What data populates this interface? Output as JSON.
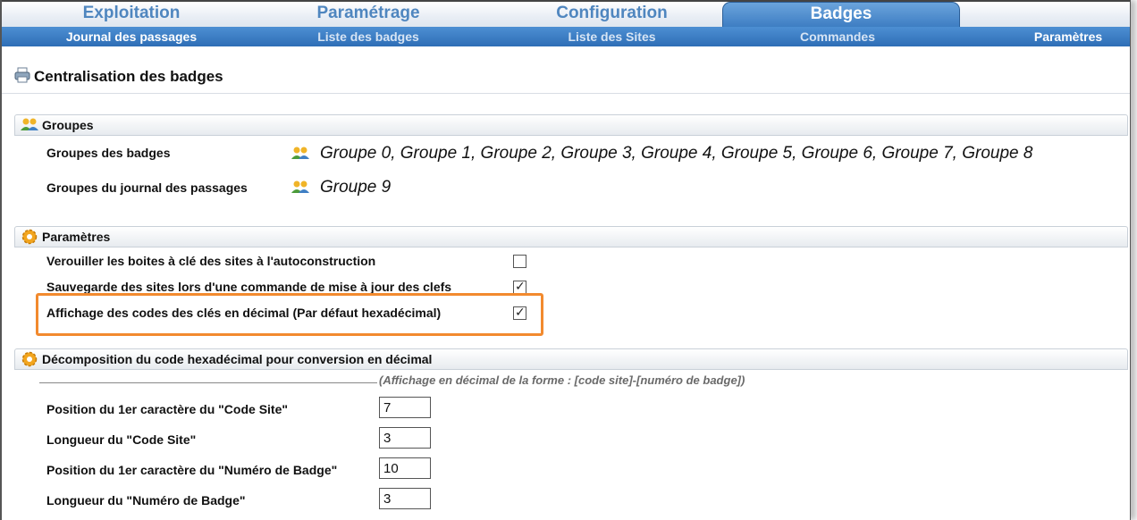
{
  "tabs": {
    "exploitation": "Exploitation",
    "parametrage": "Paramétrage",
    "configuration": "Configuration",
    "badges": "Badges"
  },
  "subnav": {
    "journal": "Journal des passages",
    "liste_badges": "Liste des badges",
    "liste_sites": "Liste des Sites",
    "commandes": "Commandes",
    "parametres": "Paramètres"
  },
  "page": {
    "title": "Centralisation des badges"
  },
  "groupes": {
    "header": "Groupes",
    "badges_label": "Groupes des badges",
    "badges_value": "Groupe 0, Groupe 1, Groupe 2, Groupe 3, Groupe 4, Groupe 5, Groupe 6, Groupe 7, Groupe 8",
    "journal_label": "Groupes du journal des passages",
    "journal_value": "Groupe 9"
  },
  "parametres": {
    "header": "Paramètres",
    "opt1_label": "Verouiller les boites à clé des sites à l'autoconstruction",
    "opt1_checked": false,
    "opt2_label": "Sauvegarde des sites lors d'une commande de mise à jour des clefs",
    "opt2_checked": true,
    "opt3_label": "Affichage des codes des clés en décimal (Par défaut hexadécimal)",
    "opt3_checked": true
  },
  "decomposition": {
    "header": "Décomposition du code hexadécimal pour conversion en décimal",
    "note": "(Affichage en décimal de la forme : [code site]-[numéro de badge])",
    "pos_site_label": "Position du 1er caractère du \"Code Site\"",
    "pos_site_value": "7",
    "len_site_label": "Longueur du \"Code Site\"",
    "len_site_value": "3",
    "pos_badge_label": "Position du 1er caractère du \"Numéro de Badge\"",
    "pos_badge_value": "10",
    "len_badge_label": "Longueur du \"Numéro de Badge\"",
    "len_badge_value": "3"
  },
  "colors": {
    "accent": "#3c7cc2",
    "highlight": "#f28a2e"
  },
  "icons": {
    "title": "printer-icon",
    "groupes": "users-group-icon",
    "parametres": "gear-icon"
  }
}
